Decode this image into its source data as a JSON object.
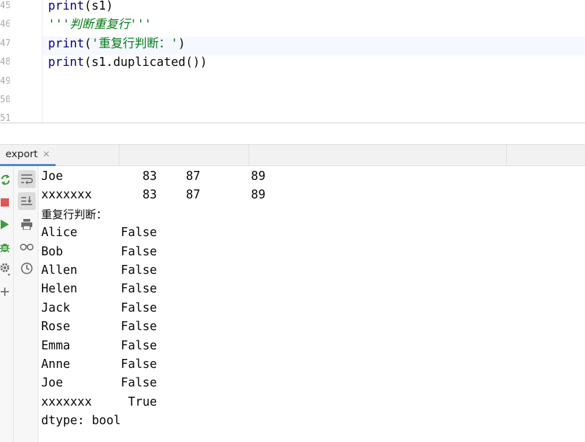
{
  "editor": {
    "line_numbers": [
      "45",
      "46",
      "47",
      "48",
      "49",
      "50",
      "51"
    ],
    "lines": [
      {
        "tokens": [
          {
            "t": "print",
            "c": "kw"
          },
          {
            "t": "(s1)",
            "c": ""
          }
        ]
      },
      {
        "tokens": [
          {
            "t": "'''判断重复行'''",
            "c": "doc"
          }
        ]
      },
      {
        "tokens": [
          {
            "t": "print",
            "c": "kw"
          },
          {
            "t": "(",
            "c": ""
          },
          {
            "t": "'重复行判断：'",
            "c": "str"
          },
          {
            "t": ")",
            "c": ""
          }
        ]
      },
      {
        "tokens": [
          {
            "t": "print",
            "c": "kw"
          },
          {
            "t": "(s1.duplicated())",
            "c": ""
          }
        ]
      },
      {
        "tokens": []
      },
      {
        "tokens": []
      },
      {
        "tokens": []
      }
    ],
    "current_line_index": 2
  },
  "run_window": {
    "tab_label": "export",
    "close_glyph": "✕"
  },
  "colors": {
    "keyword": "#000080",
    "string": "#067d17",
    "tab_underline": "#4a86c8",
    "rerun_green": "#3c9c3c",
    "stop_red": "#e05555"
  },
  "icons": {
    "left_toolbar": [
      "rerun-icon",
      "stop-icon",
      "run-icon",
      "debug-icon",
      "settings-icon",
      "add-icon"
    ],
    "second_toolbar": [
      "soft-wrap-icon",
      "scroll-to-end-icon",
      "print-icon",
      "glasses-icon",
      "history-icon"
    ]
  },
  "console": {
    "lines": [
      "Joe           83    87       89",
      "xxxxxxx       83    87       89",
      "重复行判断：",
      "Alice      False",
      "Bob        False",
      "Allen      False",
      "Helen      False",
      "Jack       False",
      "Rose       False",
      "Emma       False",
      "Anne       False",
      "Joe        False",
      "xxxxxxx     True",
      "dtype: bool"
    ]
  }
}
